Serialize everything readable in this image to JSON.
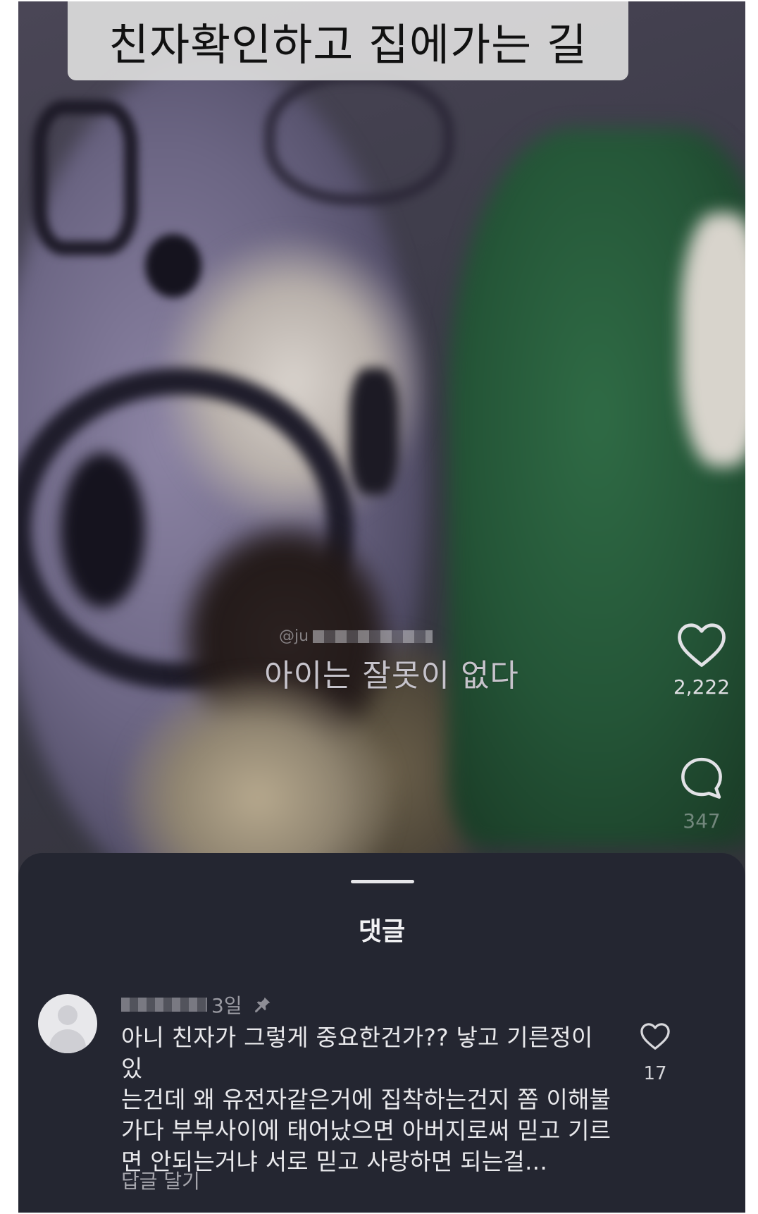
{
  "video": {
    "caption": "친자확인하고 집에가는 길",
    "handle_prefix": "@ju",
    "subtitle": "아이는 잘못이 없다"
  },
  "actions": {
    "likes": "2,222",
    "comments": "347",
    "like_icon": "heart-icon",
    "comment_icon": "speech-bubble-icon"
  },
  "comments_sheet": {
    "title": "댓글",
    "comment": {
      "age": "3일",
      "body_lines": [
        "아니 친자가 그렇게 중요한건가?? 낳고 기른정이 있",
        "는건데 왜 유전자같은거에 집착하는건지 쫌 이해불",
        "가다 부부사이에 태어났으면 아버지로써 믿고 기르",
        "면 안되는거냐 서로 믿고 사랑하면 되는걸..."
      ],
      "likes": "17",
      "reply_label": "답글 달기",
      "pin_icon": "pin-icon"
    }
  },
  "colors": {
    "sheet_bg": "#242631",
    "caption_bg": "#dcdcdc",
    "text_light": "#e9e9ec"
  }
}
